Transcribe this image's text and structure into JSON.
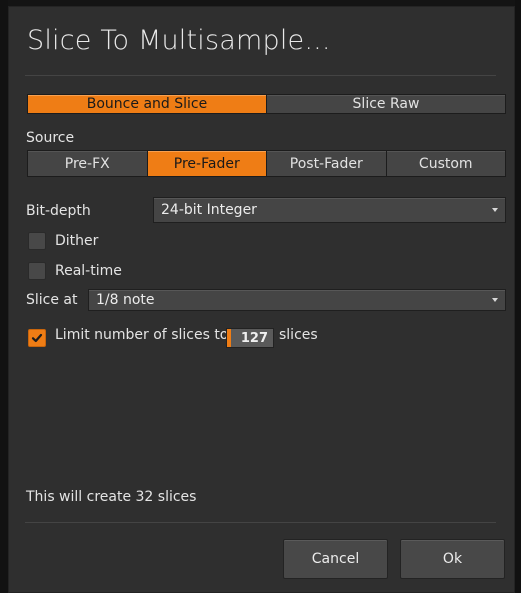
{
  "dialog": {
    "title": "Slice To Multisample..."
  },
  "mode": {
    "options": [
      "Bounce and Slice",
      "Slice Raw"
    ],
    "selected": "Bounce and Slice"
  },
  "source": {
    "label": "Source",
    "options": [
      "Pre-FX",
      "Pre-Fader",
      "Post-Fader",
      "Custom"
    ],
    "selected": "Pre-Fader"
  },
  "bit_depth": {
    "label": "Bit-depth",
    "value": "24-bit Integer"
  },
  "dither": {
    "label": "Dither",
    "checked": false
  },
  "real_time": {
    "label": "Real-time",
    "checked": false
  },
  "slice_at": {
    "label": "Slice at",
    "value": "1/8 note"
  },
  "limit": {
    "label": "Limit number of slices to",
    "checked": true,
    "value": "127",
    "suffix": "slices"
  },
  "info": {
    "text": "This will create 32 slices"
  },
  "buttons": {
    "cancel": "Cancel",
    "ok": "Ok"
  },
  "colors": {
    "accent": "#ef7d15",
    "dialog_bg": "#2f2f2f",
    "control_bg": "#454545"
  }
}
